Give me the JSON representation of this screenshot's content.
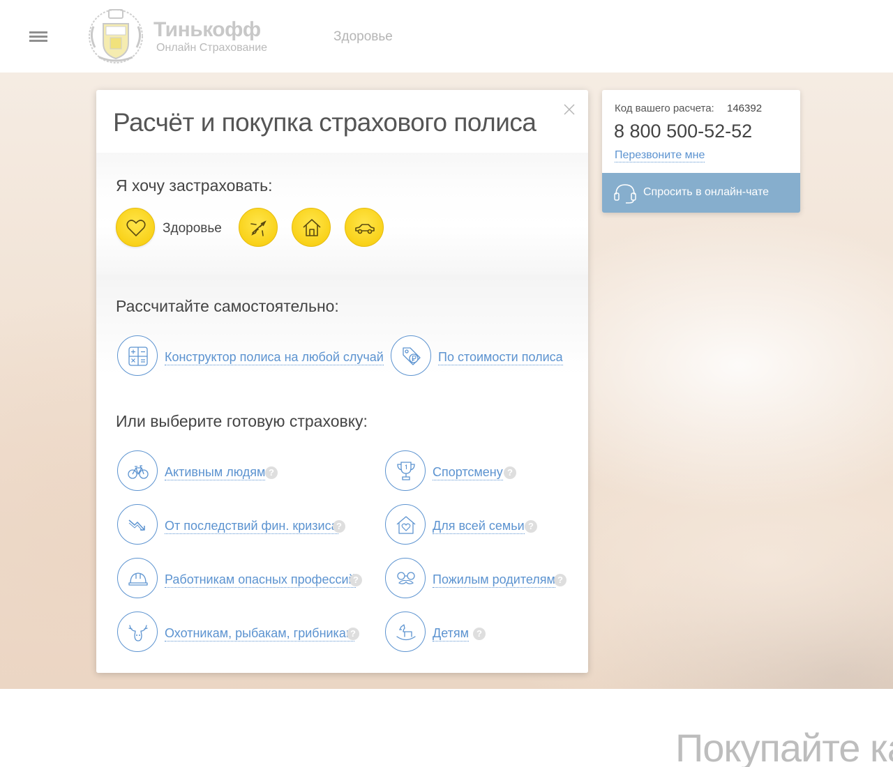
{
  "header": {
    "menu_icon": "hamburger-icon",
    "logo_name": "Тинькофф",
    "logo_sub": "Онлайн Страхование",
    "nav_health": "Здоровье"
  },
  "modal": {
    "title": "Расчёт и покупка страхового полиса",
    "close_icon": "close-icon",
    "want_insure": "Я хочу застраховать:",
    "types": [
      {
        "icon": "heart-icon",
        "label": "Здоровье",
        "active": true
      },
      {
        "icon": "airplane-icon"
      },
      {
        "icon": "house-icon"
      },
      {
        "icon": "car-icon"
      }
    ],
    "calc_title": "Рассчитайте самостоятельно:",
    "calc_links": [
      {
        "icon": "calculator-icon",
        "label": "Конструктор полиса на любой случай"
      },
      {
        "icon": "price-tag-icon",
        "label": "По стоимости полиса"
      }
    ],
    "ready_title": "Или выберите готовую страховку:",
    "products": [
      {
        "icon": "bicycle-icon",
        "label": "Активным людям"
      },
      {
        "icon": "trophy-icon",
        "label": "Спортсмену"
      },
      {
        "icon": "falling-chart-icon",
        "label": "От последствий фин. кризиса"
      },
      {
        "icon": "family-house-icon",
        "label": "Для всей семьи"
      },
      {
        "icon": "hard-hat-icon",
        "label": "Работникам опасных профессий"
      },
      {
        "icon": "glasses-mustache-icon",
        "label": "Пожилым родителям"
      },
      {
        "icon": "antlers-icon",
        "label": "Охотникам, рыбакам, грибникам"
      },
      {
        "icon": "rocking-horse-icon",
        "label": "Детям"
      }
    ],
    "help": "?"
  },
  "sidebar": {
    "code_label": "Код вашего расчета:",
    "code_value": "146392",
    "phone": "8 800 500-52-52",
    "callback": "Перезвоните мне",
    "chat_label": "Спросить в онлайн-чате",
    "chat_icon": "headset-icon"
  },
  "promo": {
    "text": "Покупайте как"
  },
  "colors": {
    "accent_yellow": "#f9d21a",
    "link_blue": "#5c93d0",
    "chat_blue": "#86aecd"
  }
}
